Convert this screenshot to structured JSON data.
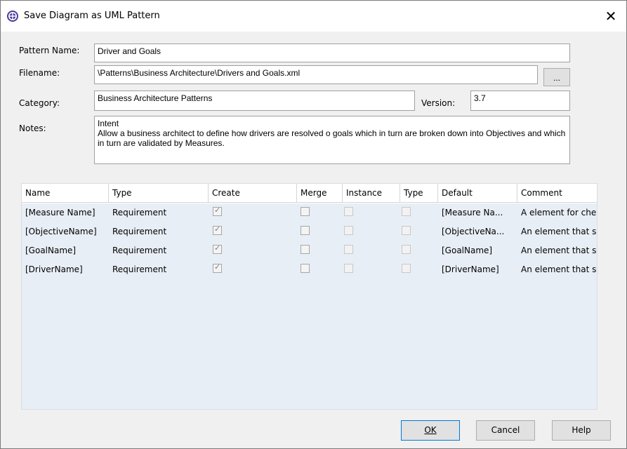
{
  "window": {
    "title": "Save Diagram as UML Pattern"
  },
  "form": {
    "pattern_name_label": "Pattern Name:",
    "pattern_name_value": "Driver and Goals",
    "filename_label": "Filename:",
    "filename_value": "\\Patterns\\Business Architecture\\Drivers and Goals.xml",
    "browse_label": "...",
    "category_label": "Category:",
    "category_value": "Business Architecture Patterns",
    "version_label": "Version:",
    "version_value": "3.7",
    "notes_label": "Notes:",
    "notes_value": "Intent\nAllow a business architect to define how drivers are resolved o goals which in turn are broken down into Objectives and which in turn are validated by Measures."
  },
  "table": {
    "columns": [
      "Name",
      "Type",
      "Create",
      "Merge",
      "Instance",
      "Type",
      "Default",
      "Comment"
    ],
    "rows": [
      {
        "name": "[Measure Name]",
        "type": "Requirement",
        "create": true,
        "merge": false,
        "instance": false,
        "type2": false,
        "default": "[Measure Na...",
        "comment": "A element for che..."
      },
      {
        "name": "[ObjectiveName]",
        "type": "Requirement",
        "create": true,
        "merge": false,
        "instance": false,
        "type2": false,
        "default": "[ObjectiveNa...",
        "comment": "An element that s..."
      },
      {
        "name": "[GoalName]",
        "type": "Requirement",
        "create": true,
        "merge": false,
        "instance": false,
        "type2": false,
        "default": "[GoalName]",
        "comment": "An element that s..."
      },
      {
        "name": "[DriverName]",
        "type": "Requirement",
        "create": true,
        "merge": false,
        "instance": false,
        "type2": false,
        "default": "[DriverName]",
        "comment": "An element that s..."
      }
    ]
  },
  "buttons": {
    "ok": "OK",
    "cancel": "Cancel",
    "help": "Help"
  },
  "icons": {
    "app": "app-logo-icon",
    "close": "close-icon",
    "check": "checkmark-icon"
  },
  "colors": {
    "grid_bg": "#e8eef5",
    "default_button_border": "#0078d7",
    "app_icon": "#4b3a9c"
  }
}
